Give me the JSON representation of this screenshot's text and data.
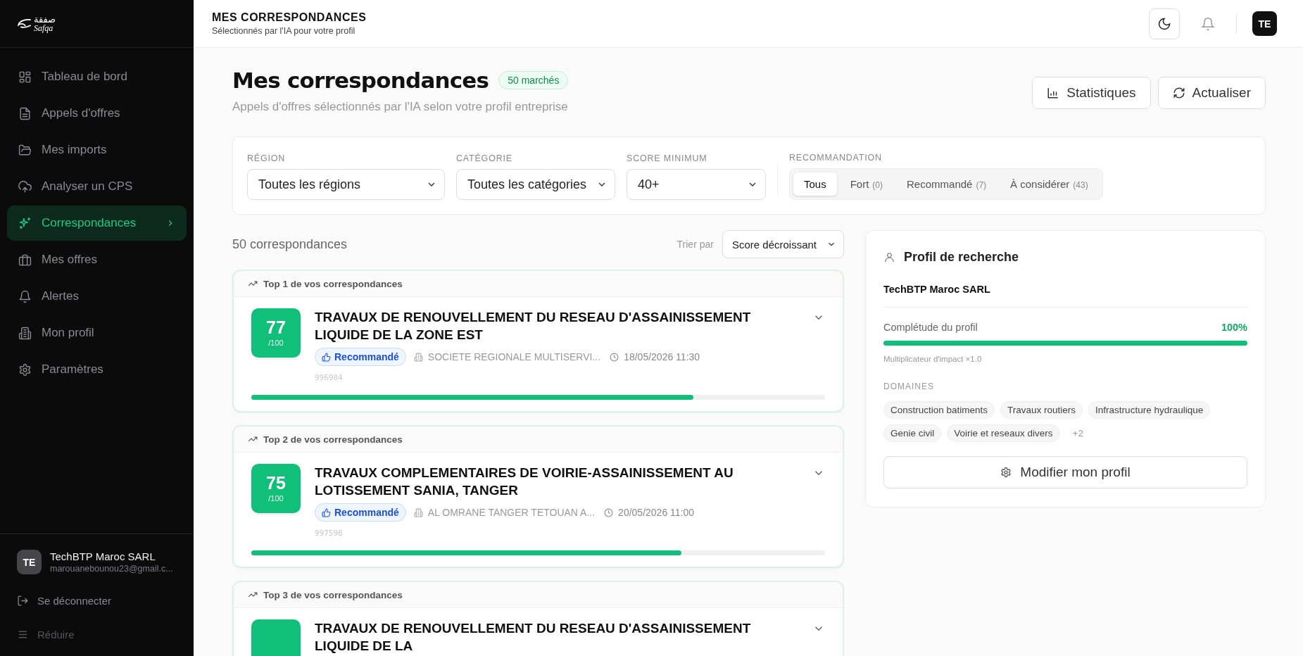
{
  "sidebar": {
    "logo_arabic": "صفقة",
    "logo_latin": "Safqa",
    "items": [
      {
        "label": "Tableau de bord",
        "selected": false
      },
      {
        "label": "Appels d'offres",
        "selected": false
      },
      {
        "label": "Mes imports",
        "selected": false
      },
      {
        "label": "Analyser un CPS",
        "selected": false
      },
      {
        "label": "Correspondances",
        "selected": true
      },
      {
        "label": "Mes offres",
        "selected": false
      },
      {
        "label": "Alertes",
        "selected": false
      },
      {
        "label": "Mon profil",
        "selected": false
      },
      {
        "label": "Paramètres",
        "selected": false
      }
    ],
    "user": {
      "initials": "TE",
      "name": "TechBTP Maroc SARL",
      "email": "marouanebounou23@gmail.c..."
    },
    "logout": "Se déconnecter",
    "collapse": "Réduire"
  },
  "header": {
    "title": "MES CORRESPONDANCES",
    "subtitle": "Sélectionnés par l'IA pour votre profil",
    "avatar": "TE"
  },
  "page": {
    "title": "Mes correspondances",
    "badge": "50 marchés",
    "subtitle": "Appels d'offres sélectionnés par l'IA selon votre profil entreprise",
    "buttons": [
      "Statistiques",
      "Actualiser"
    ]
  },
  "filters": {
    "selects": [
      {
        "label": "RÉGION",
        "value": "Toutes les régions"
      },
      {
        "label": "CATÉGORIE",
        "value": "Toutes les catégories"
      },
      {
        "label": "SCORE MINIMUM",
        "value": "40+"
      }
    ],
    "recommendation": {
      "label": "RECOMMANDATION",
      "options": [
        {
          "label": "Tous",
          "selected": true
        },
        {
          "label": "Fort",
          "count": "(0)",
          "selected": false
        },
        {
          "label": "Recommandé",
          "count": "(7)",
          "selected": false
        },
        {
          "label": "À considérer",
          "count": "(43)",
          "selected": false
        }
      ]
    }
  },
  "results": {
    "count": "50 correspondances",
    "sort_label": "Trier par",
    "sort_value": "Score décroissant",
    "cards": [
      {
        "rank": "Top 1 de vos correspondances",
        "score": "77",
        "score_max": "/100",
        "title": "TRAVAUX DE RENOUVELLEMENT DU RESEAU D'ASSAINISSEMENT LIQUIDE DE LA ZONE EST",
        "tag": "Recommandé",
        "buyer": "SOCIETE REGIONALE MULTISERVI...",
        "date": "18/05/2026 11:30",
        "ref": "996904",
        "level": 0.77
      },
      {
        "rank": "Top 2 de vos correspondances",
        "score": "75",
        "score_max": "/100",
        "title": "TRAVAUX COMPLEMENTAIRES DE VOIRIE-ASSAINISSEMENT AU LOTISSEMENT SANIA, TANGER",
        "tag": "Recommandé",
        "buyer": "AL OMRANE TANGER TETOUAN A...",
        "date": "20/05/2026 11:00",
        "ref": "997598",
        "level": 0.75
      },
      {
        "rank": "Top 3 de vos correspondances",
        "title": "TRAVAUX DE RENOUVELLEMENT DU RESEAU D'ASSAINISSEMENT LIQUIDE DE LA"
      }
    ]
  },
  "profile": {
    "title": "Profil de recherche",
    "company": "TechBTP Maroc SARL",
    "completeness_label": "Complétude du profil",
    "completeness_value": "100%",
    "level": 1.0,
    "multiplier": "Multiplicateur d'impact ×1.0",
    "domains_label": "DOMAINES",
    "domains": [
      "Construction batiments",
      "Travaux routiers",
      "Infrastructure hydraulique",
      "Genie civil",
      "Voirie et reseaux divers"
    ],
    "more": "+2",
    "button": "Modifier mon profil"
  }
}
